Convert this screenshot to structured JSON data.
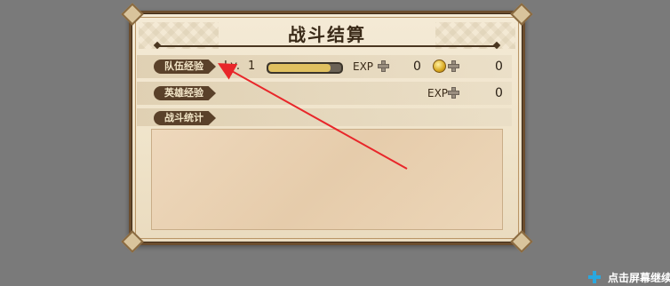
{
  "dialog": {
    "title": "战斗结算",
    "team_exp": {
      "tag": "队伍经验",
      "level_label": "Lv.",
      "level": "1",
      "exp_label": "EXP",
      "exp_value": "0",
      "coin_value": "0",
      "exp_progress": 0.85
    },
    "hero_exp": {
      "tag": "英雄经验",
      "exp_label": "EXP",
      "exp_value": "0"
    },
    "battle_stats": {
      "tag": "战斗统计"
    }
  },
  "footer": {
    "continue_label": "点击屏幕继续"
  },
  "colors": {
    "background": "#7a7a7a",
    "panel": "#f4ead6",
    "tag": "#5a412a",
    "annotation_arrow": "#e8262a",
    "continue_icon": "#29a8e0"
  },
  "icons": [
    "plus-icon",
    "coin-icon",
    "continue-icon",
    "annotation-arrow"
  ]
}
